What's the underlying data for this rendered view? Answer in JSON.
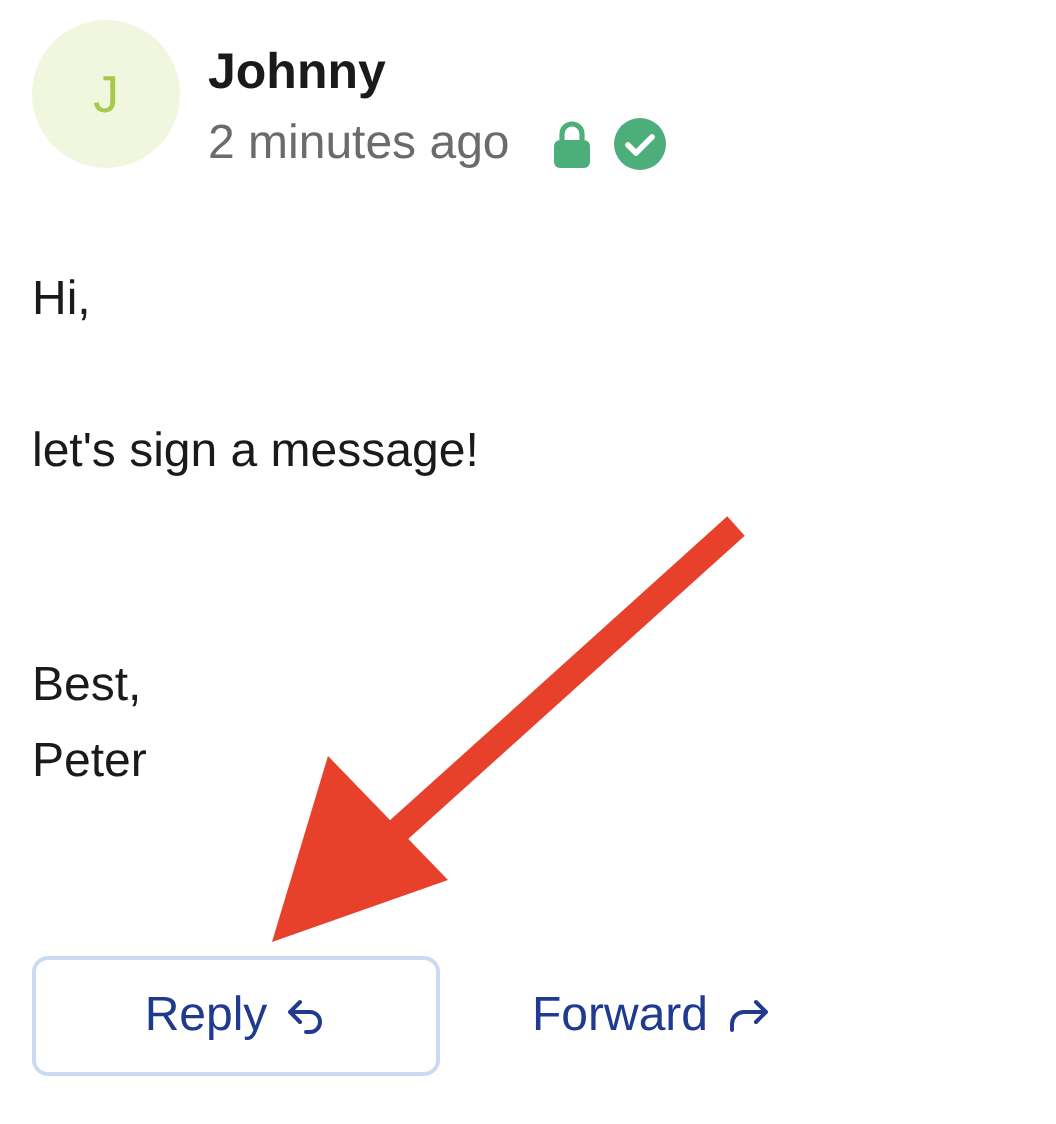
{
  "sender": {
    "initial": "J",
    "name": "Johnny",
    "time": "2 minutes ago",
    "encrypted": true,
    "verified": true
  },
  "body": {
    "greeting": "Hi,",
    "message": "let's sign a message!"
  },
  "signature": [
    "Best,",
    "Peter"
  ],
  "actions": [
    {
      "label": "Reply",
      "kind": "reply",
      "selected": true
    },
    {
      "label": "Forward",
      "kind": "forward",
      "selected": false
    }
  ]
}
